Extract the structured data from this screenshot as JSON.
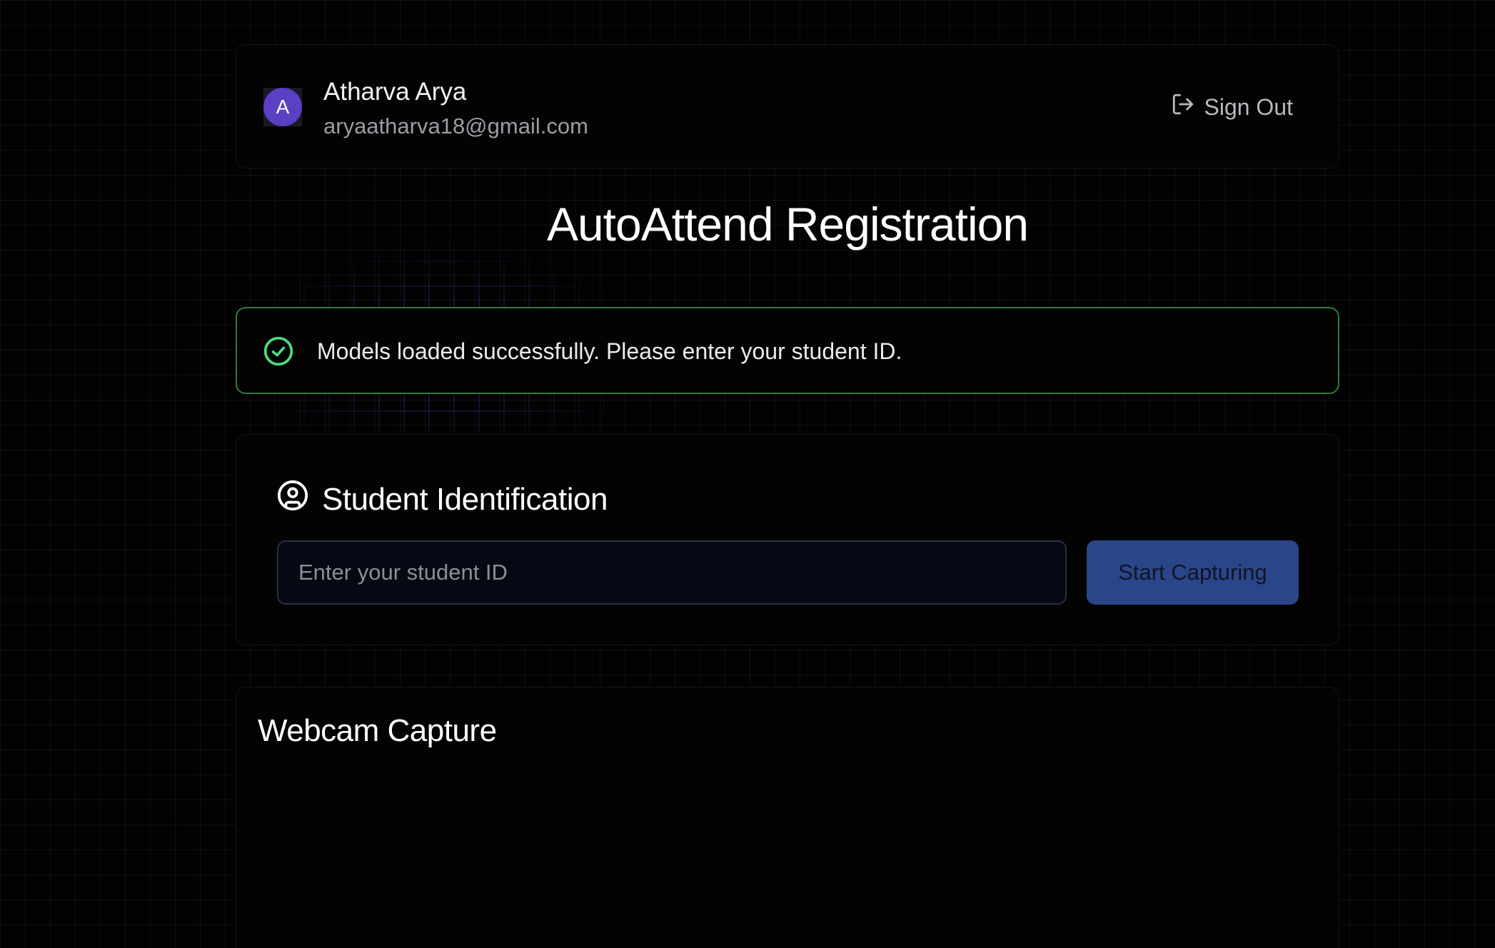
{
  "user": {
    "avatar_initial": "A",
    "name": "Atharva Arya",
    "email": "aryaatharva18@gmail.com"
  },
  "header": {
    "signout_label": "Sign Out",
    "signout_icon": "sign-out-icon"
  },
  "page": {
    "title": "AutoAttend Registration"
  },
  "status": {
    "icon": "check-circle-icon",
    "message": "Models loaded successfully. Please enter your student ID.",
    "color": "#4ade80"
  },
  "student_id_section": {
    "icon": "user-circle-icon",
    "heading": "Student Identification",
    "input_placeholder": "Enter your student ID",
    "input_value": "",
    "button_label": "Start Capturing"
  },
  "webcam_section": {
    "heading": "Webcam Capture"
  },
  "colors": {
    "accent": "#2a4589",
    "avatar": "#5b3fc4",
    "success_border": "#2f7a3e"
  }
}
